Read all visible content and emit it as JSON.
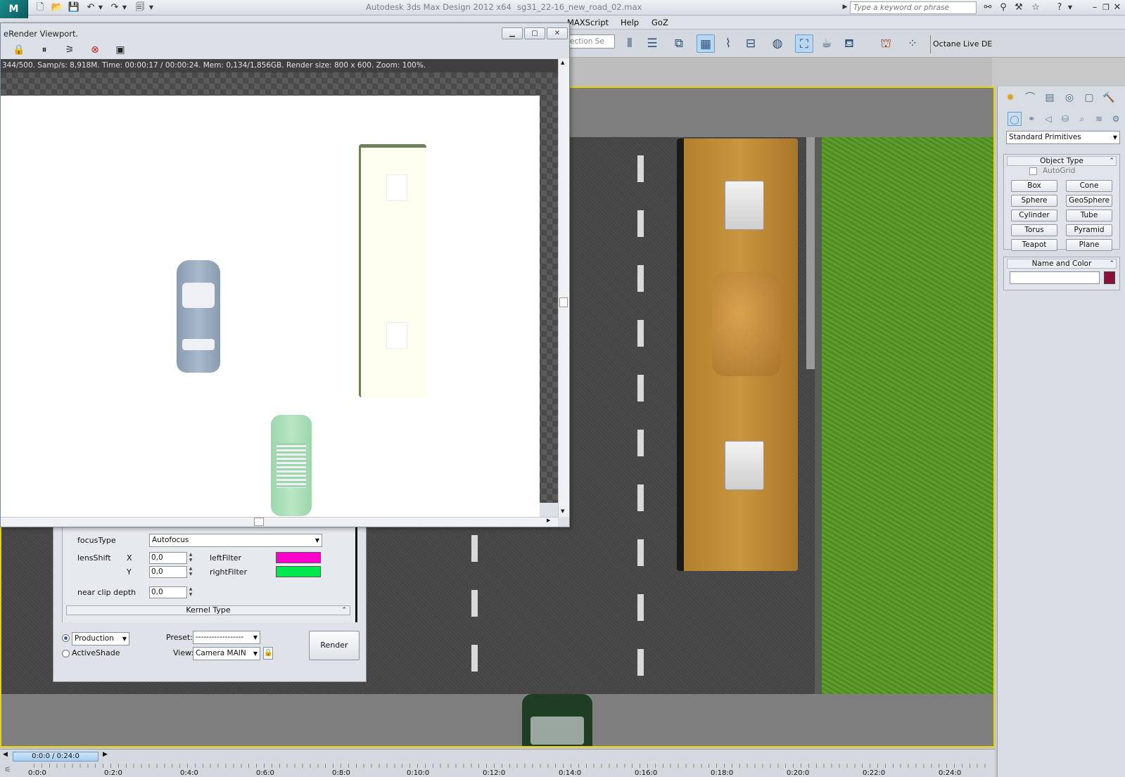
{
  "app": {
    "logo": "M",
    "title": "Autodesk 3ds Max Design 2012 x64",
    "file": "sg31_22-16_new_road_02.max",
    "search_placeholder": "Type a keyword or phrase"
  },
  "menu": {
    "items": [
      "MAXScript",
      "Help",
      "GoZ"
    ]
  },
  "toolbar": {
    "selection_set_placeholder": "ection Se",
    "octane_button": "Octane Live DE"
  },
  "render_window": {
    "title": "eRender Viewport.",
    "status": "344/500.   Samp/s: 8,918M.   Time: 00:00:17 / 00:00:24.   Mem: 0,134/1,856GB.   Render size: 800 x 600.   Zoom: 100%."
  },
  "command_panel": {
    "category": "Standard Primitives",
    "object_type": {
      "title": "Object Type",
      "autogrid": "AutoGrid",
      "buttons": [
        "Box",
        "Cone",
        "Sphere",
        "GeoSphere",
        "Cylinder",
        "Tube",
        "Torus",
        "Pyramid",
        "Teapot",
        "Plane"
      ]
    },
    "name_and_color": {
      "title": "Name and Color",
      "name_value": "",
      "color": "#8a1038"
    }
  },
  "render_settings": {
    "focus_type_label": "focusType",
    "focus_type_value": "Autofocus",
    "lens_shift_label": "lensShift",
    "x_label": "X",
    "y_label": "Y",
    "lens_shift_x": "0,0",
    "lens_shift_y": "0,0",
    "left_filter_label": "leftFilter",
    "right_filter_label": "rightFilter",
    "left_filter_color": "#ff00cc",
    "right_filter_color": "#00e64d",
    "near_clip_label": "near clip depth",
    "near_clip_value": "0,0",
    "kernel_type": "Kernel Type",
    "mode_production": "Production",
    "mode_activeshade": "ActiveShade",
    "preset_label": "Preset:",
    "preset_value": "------------------",
    "view_label": "View:",
    "view_value": "Camera MAIN",
    "render_button": "Render"
  },
  "timeline": {
    "current": "0:0:0 / 0:24:0",
    "ticks": [
      "0:0:0",
      "0:2:0",
      "0:4:0",
      "0:6:0",
      "0:8:0",
      "0:10:0",
      "0:12:0",
      "0:14:0",
      "0:16:0",
      "0:18:0",
      "0:20:0",
      "0:22:0",
      "0:24:0"
    ]
  }
}
